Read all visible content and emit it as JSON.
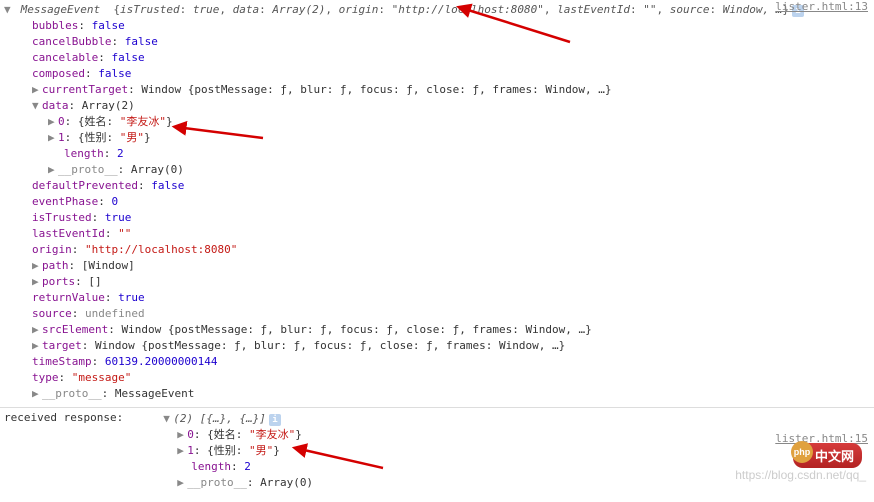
{
  "source1": "lister.html:13",
  "source2": "lister.html:15",
  "header": {
    "type": "MessageEvent",
    "preview_parts": {
      "isTrusted_k": "isTrusted",
      "isTrusted_v": "true",
      "data_k": "data",
      "data_v": "Array(2)",
      "origin_k": "origin",
      "origin_v": "\"http://localhost:8080\"",
      "lastEventId_k": "lastEventId",
      "lastEventId_v": "\"\"",
      "source_k": "source",
      "source_v": "Window",
      "ellipsis": ", …"
    }
  },
  "props": {
    "bubbles_k": "bubbles",
    "bubbles_v": "false",
    "cancelBubble_k": "cancelBubble",
    "cancelBubble_v": "false",
    "cancelable_k": "cancelable",
    "cancelable_v": "false",
    "composed_k": "composed",
    "composed_v": "false",
    "currentTarget_k": "currentTarget",
    "currentTarget_v": "Window {postMessage: ƒ, blur: ƒ, focus: ƒ, close: ƒ, frames: Window, …}",
    "data_k": "data",
    "data_v": "Array(2)",
    "d0_k": "0",
    "d0_v": "{姓名: \"李友冰\"}",
    "d1_k": "1",
    "d1_v": "{性别: \"男\"}",
    "length_k": "length",
    "length_v": "2",
    "proto_arr_k": "__proto__",
    "proto_arr_v": "Array(0)",
    "defaultPrevented_k": "defaultPrevented",
    "defaultPrevented_v": "false",
    "eventPhase_k": "eventPhase",
    "eventPhase_v": "0",
    "isTrusted_k": "isTrusted",
    "isTrusted_v": "true",
    "lastEventId_k": "lastEventId",
    "lastEventId_v": "\"\"",
    "origin_k": "origin",
    "origin_v": "\"http://localhost:8080\"",
    "path_k": "path",
    "path_v": "[Window]",
    "ports_k": "ports",
    "ports_v": "[]",
    "returnValue_k": "returnValue",
    "returnValue_v": "true",
    "source_k": "source",
    "source_v": "undefined",
    "srcElement_k": "srcElement",
    "srcElement_v": "Window {postMessage: ƒ, blur: ƒ, focus: ƒ, close: ƒ, frames: Window, …}",
    "target_k": "target",
    "target_v": "Window {postMessage: ƒ, blur: ƒ, focus: ƒ, close: ƒ, frames: Window, …}",
    "timeStamp_k": "timeStamp",
    "timeStamp_v": "60139.20000000144",
    "type_k": "type",
    "type_v": "\"message\"",
    "proto_me_k": "__proto__",
    "proto_me_v": "MessageEvent"
  },
  "resp": {
    "label": "received response:  ",
    "head": "(2) [{…}, {…}]",
    "d0_k": "0",
    "d0_v": "{姓名: \"李友冰\"}",
    "d1_k": "1",
    "d1_v": "{性别: \"男\"}",
    "length_k": "length",
    "length_v": "2",
    "proto_k": "__proto__",
    "proto_v": "Array(0)"
  },
  "watermark": "https://blog.csdn.net/qq_",
  "cnlogo": "中文网"
}
